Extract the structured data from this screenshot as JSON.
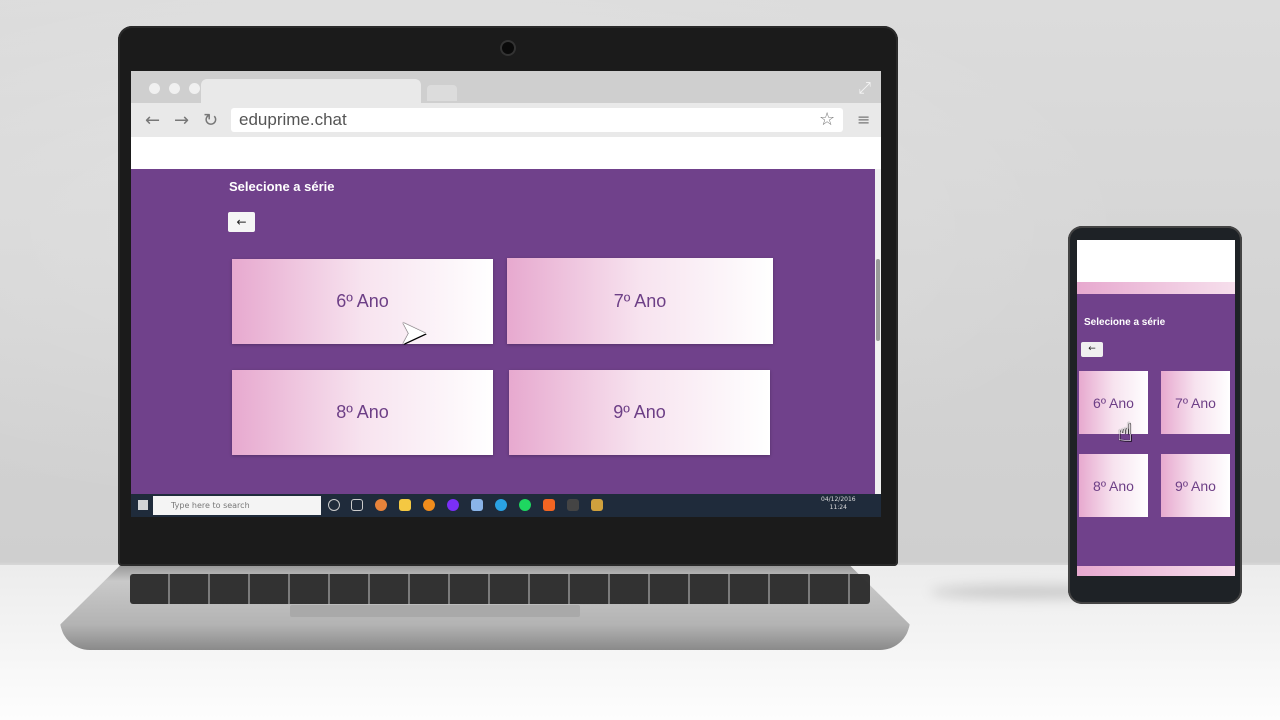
{
  "browser": {
    "url": "eduprime.chat",
    "back_icon": "←",
    "forward_icon": "→",
    "reload_icon": "↻",
    "star_icon": "☆",
    "menu_icon": "≡",
    "expand_icon": "⤢"
  },
  "page": {
    "title": "Selecione a série",
    "back_button": "←",
    "grades": [
      "6º Ano",
      "7º Ano",
      "8º Ano",
      "9º Ano"
    ]
  },
  "taskbar": {
    "search_placeholder": "Type here to search",
    "clock_time": "11:24",
    "clock_date": "04/12/2016"
  },
  "mobile": {
    "title": "Selecione a série",
    "back_button": "←",
    "grades": [
      "6º Ano",
      "7º Ano",
      "8º Ano",
      "9º Ano"
    ]
  },
  "colors": {
    "page_purple": "#70418b",
    "card_pink": "#e7a9cf",
    "card_text": "#6d3f86"
  }
}
